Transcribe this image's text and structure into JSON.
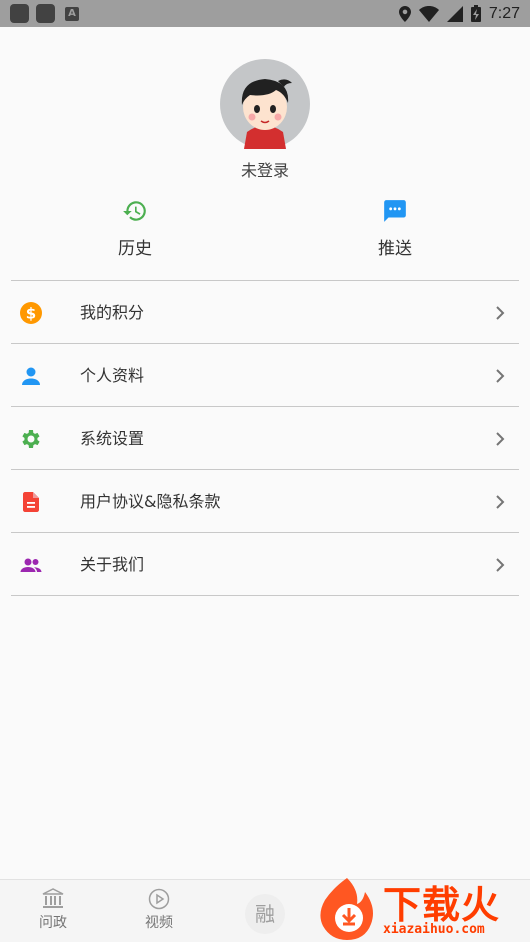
{
  "status_bar": {
    "time": "7:27"
  },
  "profile": {
    "login_status": "未登录"
  },
  "quick_actions": [
    {
      "label": "历史",
      "icon": "history-icon",
      "color": "#4caf50"
    },
    {
      "label": "推送",
      "icon": "message-icon",
      "color": "#2196f3"
    }
  ],
  "menu": [
    {
      "label": "我的积分",
      "icon": "dollar-coin-icon",
      "color": "#ff9800"
    },
    {
      "label": "个人资料",
      "icon": "person-icon",
      "color": "#2196f3"
    },
    {
      "label": "系统设置",
      "icon": "gear-icon",
      "color": "#4caf50"
    },
    {
      "label": "用户协议&隐私条款",
      "icon": "document-icon",
      "color": "#f44336"
    },
    {
      "label": "关于我们",
      "icon": "group-icon",
      "color": "#9c27b0"
    }
  ],
  "bottom_nav": {
    "tabs": [
      {
        "label": "问政",
        "icon": "government-building-icon"
      },
      {
        "label": "视频",
        "icon": "play-circle-icon"
      }
    ],
    "center": {
      "label": "融"
    }
  },
  "watermark": {
    "brand": "下载火",
    "url": "xiazaihuo.com"
  }
}
